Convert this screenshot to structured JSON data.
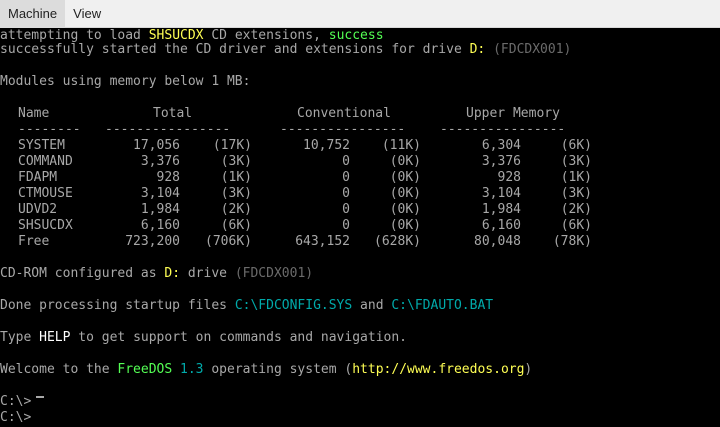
{
  "menubar": {
    "items": [
      {
        "label": "Machine"
      },
      {
        "label": "View"
      }
    ]
  },
  "terminal": {
    "line1": {
      "prefix": "attempting to load ",
      "driver": "SHSUCDX",
      "mid": " CD extensions, ",
      "status": "success"
    },
    "line2": {
      "prefix": "successfully started the CD driver and extensions for drive ",
      "drive": "D:",
      "space": " ",
      "device": "(FDCDX001)"
    },
    "modules_header": "Modules using memory below 1 MB:",
    "table": {
      "headers": [
        "Name",
        "Total",
        "Conventional",
        "Upper Memory"
      ],
      "rules": [
        "--------",
        "----------------",
        "----------------",
        "----------------"
      ],
      "rows": [
        [
          "SYSTEM",
          "17,056",
          "(17K)",
          "10,752",
          "(11K)",
          "6,304",
          "(6K)"
        ],
        [
          "COMMAND",
          "3,376",
          "(3K)",
          "0",
          "(0K)",
          "3,376",
          "(3K)"
        ],
        [
          "FDAPM",
          "928",
          "(1K)",
          "0",
          "(0K)",
          "928",
          "(1K)"
        ],
        [
          "CTMOUSE",
          "3,104",
          "(3K)",
          "0",
          "(0K)",
          "3,104",
          "(3K)"
        ],
        [
          "UDVD2",
          "1,984",
          "(2K)",
          "0",
          "(0K)",
          "1,984",
          "(2K)"
        ],
        [
          "SHSUCDX",
          "6,160",
          "(6K)",
          "0",
          "(0K)",
          "6,160",
          "(6K)"
        ],
        [
          "Free",
          "723,200",
          "(706K)",
          "643,152",
          "(628K)",
          "80,048",
          "(78K)"
        ]
      ]
    },
    "cdrom": {
      "prefix": "CD-ROM configured as ",
      "drive": "D:",
      "mid": " drive ",
      "device": "(FDCDX001)"
    },
    "startup": {
      "prefix": "Done processing startup files ",
      "config": "C:\\FDCONFIG.SYS",
      "mid": " and ",
      "auto": "C:\\FDAUTO.BAT"
    },
    "help": {
      "prefix": "Type ",
      "cmd": "HELP",
      "suffix": " to get support on commands and navigation."
    },
    "welcome": {
      "prefix": "Welcome to the ",
      "os": "FreeDOS",
      "space": " ",
      "version": "1.3",
      "mid": " operating system (",
      "url": "http://www.freedos.org",
      "close": ")"
    },
    "prompt1": "C:\\>",
    "prompt2": "C:\\>"
  },
  "colors": {
    "background": "#000000",
    "text": "#a8a8a8",
    "highlight_white": "#ffffff",
    "highlight_yellow": "#ffff54",
    "highlight_green": "#54ff54",
    "cyan": "#00aaaa",
    "dim": "#6b6b6b"
  }
}
